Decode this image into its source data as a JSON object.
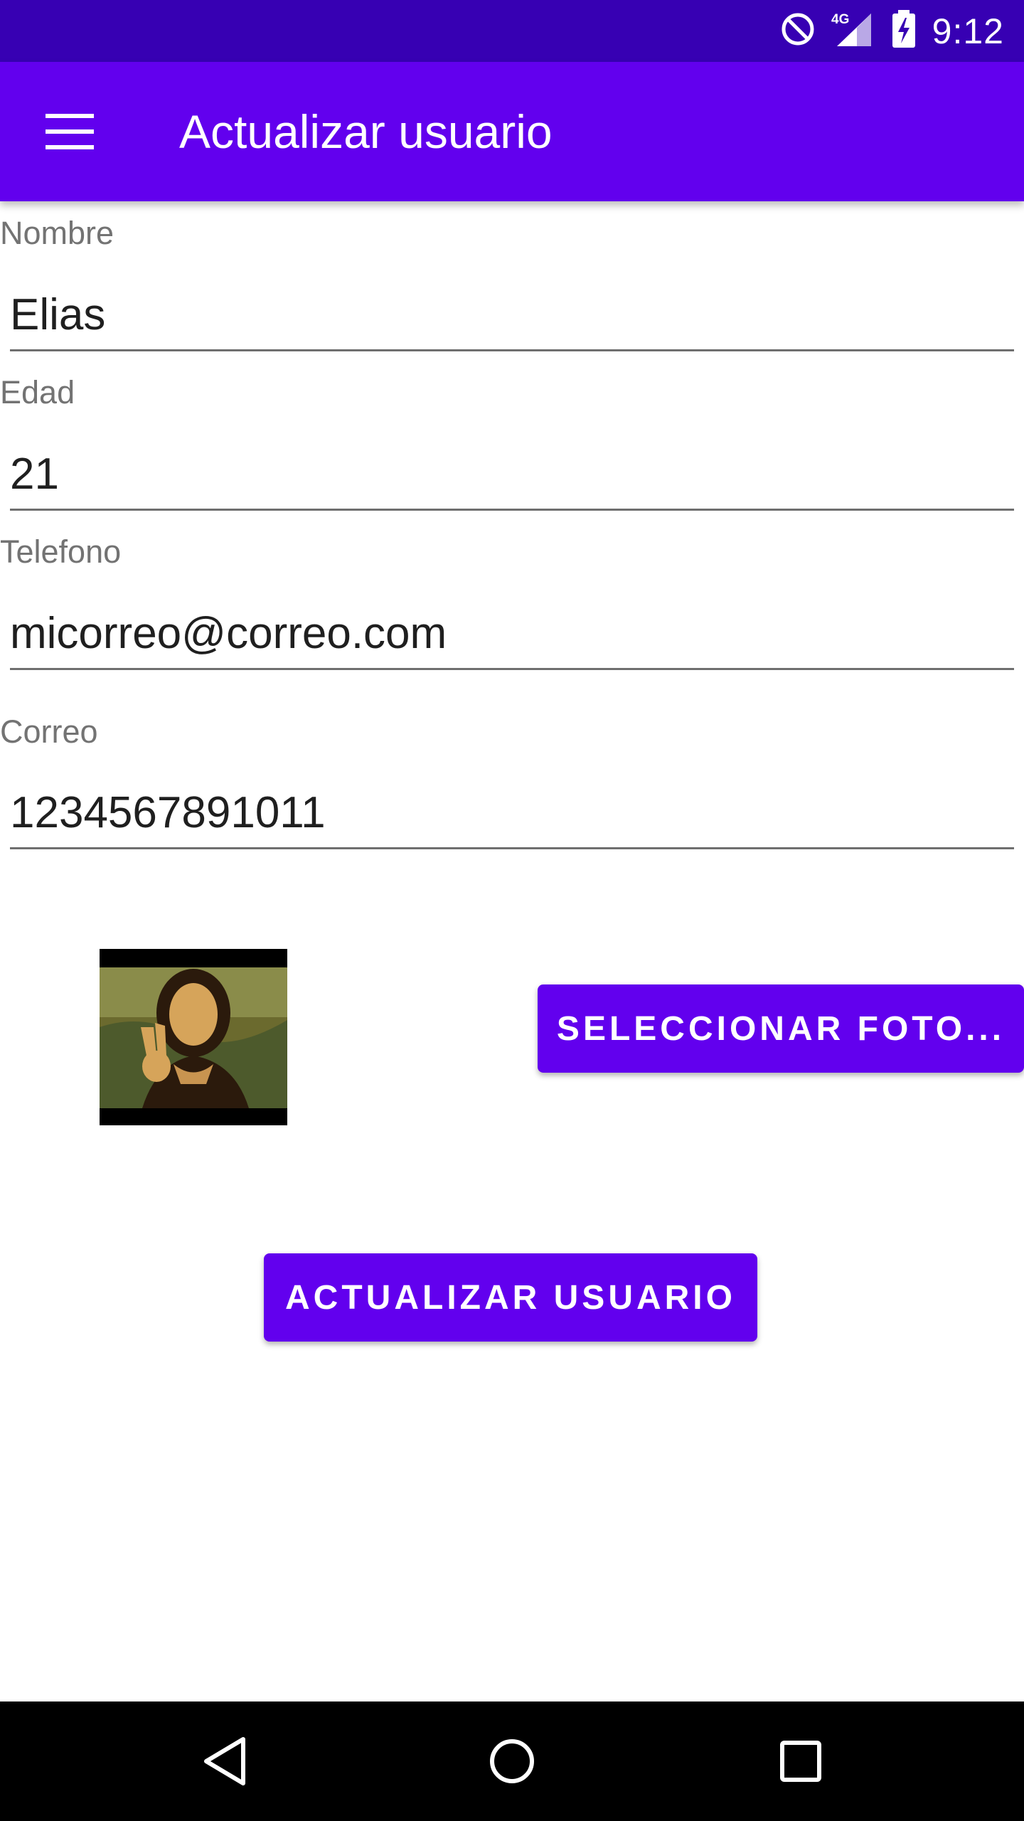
{
  "status_bar": {
    "time": "9:12",
    "network": "4G",
    "icons": [
      "do-not-disturb-icon",
      "signal-4g-icon",
      "battery-charging-icon"
    ]
  },
  "app_bar": {
    "title": "Actualizar usuario",
    "menu_icon": "hamburger-menu-icon",
    "color": "#6200ee"
  },
  "form": {
    "nombre": {
      "label": "Nombre",
      "value": "Elias"
    },
    "edad": {
      "label": "Edad",
      "value": "21"
    },
    "telefono": {
      "label": "Telefono",
      "value": "micorreo@correo.com"
    },
    "correo": {
      "label": "Correo",
      "value": "1234567891011"
    }
  },
  "photo": {
    "icon": "user-photo-thumbnail"
  },
  "buttons": {
    "select_photo": "SELECCIONAR FOTO...",
    "update_user": "ACTUALIZAR USUARIO"
  },
  "nav_bar": {
    "icons": [
      "back-icon",
      "home-icon",
      "recents-icon"
    ]
  },
  "colors": {
    "primary": "#6200ee",
    "primary_dark": "#3700b3"
  }
}
